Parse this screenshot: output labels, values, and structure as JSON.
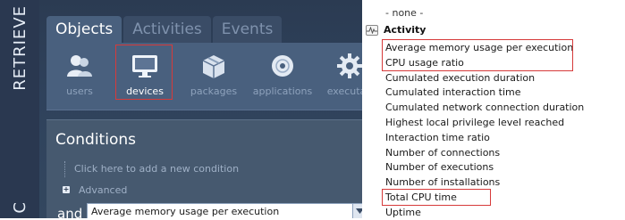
{
  "sidebar": {
    "tabs": [
      "RETRIEVE",
      "C"
    ]
  },
  "object_tabs": [
    {
      "label": "Objects",
      "active": true
    },
    {
      "label": "Activities",
      "active": false
    },
    {
      "label": "Events",
      "active": false
    }
  ],
  "objects": [
    {
      "label": "users",
      "icon": "users-icon",
      "selected": false
    },
    {
      "label": "devices",
      "icon": "monitor-icon",
      "selected": true
    },
    {
      "label": "packages",
      "icon": "package-icon",
      "selected": false
    },
    {
      "label": "applications",
      "icon": "disc-icon",
      "selected": false
    },
    {
      "label": "executab",
      "icon": "gear-icon",
      "selected": false
    }
  ],
  "conditions": {
    "title": "Conditions",
    "add_condition": "Click here to add a new condition",
    "advanced": "Advanced",
    "and_label": "and",
    "selected_value": "Average memory usage per execution"
  },
  "dropdown": {
    "none_option": "- none -",
    "group_header": "Activity",
    "options": [
      "Average memory usage per execution",
      "CPU usage ratio",
      "Cumulated execution duration",
      "Cumulated interaction time",
      "Cumulated network connection duration",
      "Highest local privilege level reached",
      "Interaction time ratio",
      "Number of connections",
      "Number of executions",
      "Number of installations",
      "Total CPU time",
      "Uptime"
    ],
    "highlighted_groups": [
      [
        0,
        1
      ],
      [
        10,
        10
      ]
    ]
  },
  "colors": {
    "panel_dark": "#2b3b52",
    "panel_mid": "#49607e",
    "highlight_red": "#d63a3a",
    "text_light": "#ffffff",
    "text_muted": "#8ea2bc"
  }
}
